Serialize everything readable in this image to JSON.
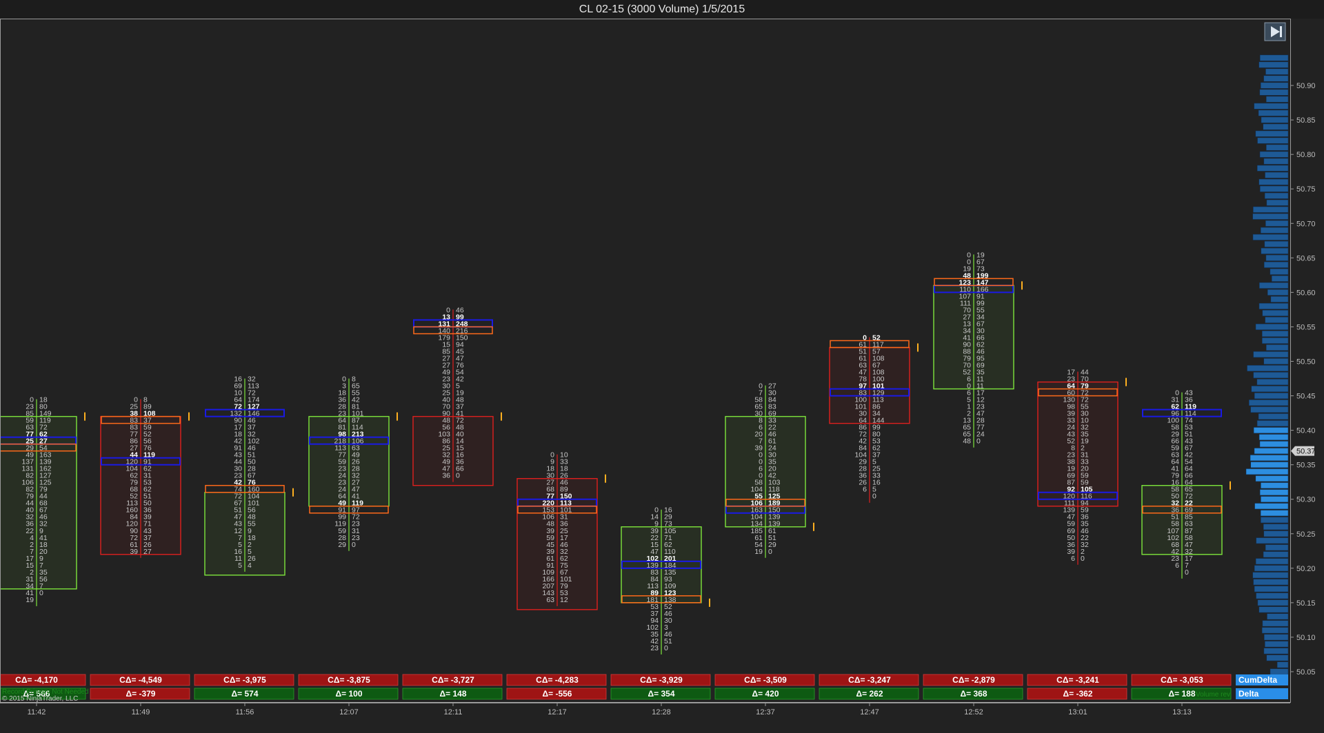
{
  "title": "CL 02-15 (3000 Volume)  1/5/2015",
  "buttons": {
    "go_to_end_icon": "skip-to-end-icon"
  },
  "footer": {
    "status_text": "Record Primary Not Needed",
    "copyright": "© 2015 NinjaTrader, LLC",
    "volume_label": "Volume rev"
  },
  "labels": {
    "cum_delta": "CumDelta",
    "delta": "Delta"
  },
  "colors": {
    "background": "#222222",
    "bull": "#7ee63c",
    "bear": "#e0201e",
    "poc": "#1a1ae6",
    "va_edge": "#ff6a1a",
    "profile_bar": "#1e5a96",
    "profile_hi": "#2d8ee0",
    "cum_cell": "#9e1414",
    "pos_delta": "#0e5a12",
    "neg_delta": "#9e1414",
    "label_bg": "#2a8ee8"
  },
  "chart_data": {
    "type": "footprint",
    "yaxis": {
      "ticks": [
        "50.90",
        "50.85",
        "50.80",
        "50.75",
        "50.70",
        "50.65",
        "50.60",
        "50.55",
        "50.50",
        "50.45",
        "50.40",
        "50.35",
        "50.30",
        "50.25",
        "50.20",
        "50.15",
        "50.10",
        "50.05"
      ],
      "min": 50.03,
      "max": 50.95,
      "last_price": "50.37"
    },
    "bars": [
      {
        "time": "11:42",
        "top": 50.44,
        "dir": "bull",
        "open": 50.42,
        "close": 50.17,
        "pocRow": 6,
        "vaRow": 7,
        "cum": "CΔ= -4,170",
        "delta": "Δ= 566",
        "deltaSign": "pos",
        "bid": [
          "0",
          "23",
          "85",
          "59",
          "63",
          "77",
          "25",
          "29",
          "49",
          "137",
          "131",
          "82",
          "106",
          "82",
          "79",
          "44",
          "40",
          "32",
          "36",
          "22",
          "4",
          "2",
          "7",
          "17",
          "15",
          "2",
          "31",
          "34",
          "41",
          "19"
        ],
        "ask": [
          "18",
          "80",
          "149",
          "119",
          "72",
          "62",
          "27",
          "54",
          "163",
          "139",
          "162",
          "127",
          "125",
          "79",
          "44",
          "68",
          "67",
          "46",
          "32",
          "9",
          "41",
          "18",
          "20",
          "9",
          "7",
          "35",
          "56",
          "7",
          "0",
          ""
        ]
      },
      {
        "time": "11:49",
        "top": 50.44,
        "dir": "bear",
        "open": 50.42,
        "close": 50.22,
        "pocRow": 9,
        "vaRow": 3,
        "cum": "CΔ= -4,549",
        "delta": "Δ= -379",
        "deltaSign": "neg",
        "bid": [
          "0",
          "25",
          "38",
          "83",
          "83",
          "77",
          "86",
          "27",
          "44",
          "120",
          "104",
          "62",
          "79",
          "68",
          "52",
          "113",
          "160",
          "84",
          "120",
          "90",
          "72",
          "61",
          "39"
        ],
        "ask": [
          "8",
          "89",
          "108",
          "37",
          "59",
          "52",
          "56",
          "76",
          "119",
          "91",
          "62",
          "31",
          "53",
          "62",
          "51",
          "50",
          "36",
          "39",
          "71",
          "43",
          "37",
          "26",
          "27"
        ]
      },
      {
        "time": "11:56",
        "top": 50.47,
        "dir": "bull",
        "open": 50.31,
        "close": 50.19,
        "pocRow": 5,
        "vaRow": 16,
        "cum": "CΔ= -3,975",
        "delta": "Δ= 574",
        "deltaSign": "pos",
        "bid": [
          "16",
          "69",
          "10",
          "64",
          "72",
          "132",
          "90",
          "17",
          "18",
          "42",
          "91",
          "43",
          "44",
          "30",
          "23",
          "42",
          "74",
          "72",
          "67",
          "51",
          "47",
          "43",
          "12",
          "7",
          "5",
          "16",
          "11",
          "5"
        ],
        "ask": [
          "32",
          "113",
          "72",
          "174",
          "127",
          "146",
          "46",
          "37",
          "32",
          "102",
          "46",
          "51",
          "50",
          "28",
          "67",
          "76",
          "160",
          "104",
          "101",
          "56",
          "48",
          "55",
          "9",
          "18",
          "2",
          "5",
          "26",
          "4"
        ]
      },
      {
        "time": "12:07",
        "top": 50.47,
        "dir": "bull",
        "open": 50.42,
        "close": 50.29,
        "pocRow": 9,
        "vaRow": 19,
        "cum": "CΔ= -3,875",
        "delta": "Δ= 100",
        "deltaSign": "pos",
        "bid": [
          "0",
          "3",
          "18",
          "36",
          "28",
          "23",
          "64",
          "81",
          "98",
          "218",
          "113",
          "77",
          "59",
          "23",
          "24",
          "23",
          "24",
          "64",
          "49",
          "91",
          "99",
          "119",
          "59",
          "28",
          "29"
        ],
        "ask": [
          "8",
          "65",
          "55",
          "42",
          "81",
          "101",
          "87",
          "114",
          "213",
          "106",
          "63",
          "49",
          "26",
          "28",
          "32",
          "27",
          "47",
          "41",
          "119",
          "97",
          "72",
          "23",
          "31",
          "23",
          "0"
        ]
      },
      {
        "time": "12:11",
        "top": 50.57,
        "dir": "bear",
        "open": 50.42,
        "close": 50.32,
        "pocRow": 2,
        "vaRow": 3,
        "cum": "CΔ= -3,727",
        "delta": "Δ= 148",
        "deltaSign": "pos",
        "bid": [
          "0",
          "13",
          "131",
          "140",
          "179",
          "15",
          "85",
          "27",
          "27",
          "49",
          "23",
          "30",
          "25",
          "40",
          "70",
          "90",
          "48",
          "56",
          "103",
          "86",
          "25",
          "32",
          "49",
          "47",
          "36"
        ],
        "ask": [
          "46",
          "99",
          "248",
          "216",
          "150",
          "94",
          "45",
          "47",
          "76",
          "54",
          "42",
          "5",
          "19",
          "48",
          "37",
          "41",
          "72",
          "48",
          "40",
          "14",
          "15",
          "16",
          "36",
          "66",
          "0"
        ]
      },
      {
        "time": "12:17",
        "top": 50.36,
        "dir": "bear",
        "open": 50.33,
        "close": 50.14,
        "pocRow": 7,
        "vaRow": 8,
        "cum": "CΔ= -4,283",
        "delta": "Δ= -556",
        "deltaSign": "neg",
        "bid": [
          "0",
          "9",
          "18",
          "30",
          "27",
          "68",
          "77",
          "220",
          "153",
          "106",
          "48",
          "39",
          "59",
          "45",
          "39",
          "61",
          "91",
          "109",
          "166",
          "207",
          "143",
          "63"
        ],
        "ask": [
          "10",
          "33",
          "18",
          "26",
          "46",
          "89",
          "150",
          "113",
          "101",
          "31",
          "36",
          "25",
          "17",
          "46",
          "32",
          "62",
          "75",
          "67",
          "101",
          "79",
          "53",
          "12"
        ]
      },
      {
        "time": "12:28",
        "top": 50.28,
        "dir": "bull",
        "open": 50.15,
        "close": 50.26,
        "pocRow": 8,
        "vaRow": 13,
        "cum": "CΔ= -3,929",
        "delta": "Δ= 354",
        "deltaSign": "pos",
        "bid": [
          "0",
          "14",
          "9",
          "39",
          "22",
          "15",
          "47",
          "102",
          "139",
          "83",
          "84",
          "113",
          "89",
          "181",
          "53",
          "37",
          "94",
          "102",
          "35",
          "42",
          "23"
        ],
        "ask": [
          "16",
          "29",
          "73",
          "105",
          "71",
          "62",
          "110",
          "201",
          "184",
          "135",
          "93",
          "109",
          "123",
          "138",
          "52",
          "46",
          "30",
          "3",
          "46",
          "51",
          "0"
        ]
      },
      {
        "time": "12:37",
        "top": 50.46,
        "dir": "bull",
        "open": 50.26,
        "close": 50.42,
        "pocRow": 18,
        "vaRow": 17,
        "cum": "CΔ= -3,509",
        "delta": "Δ= 420",
        "deltaSign": "pos",
        "bid": [
          "0",
          "7",
          "58",
          "65",
          "30",
          "8",
          "6",
          "20",
          "7",
          "39",
          "0",
          "0",
          "6",
          "0",
          "58",
          "104",
          "55",
          "106",
          "163",
          "104",
          "134",
          "185",
          "61",
          "54",
          "19"
        ],
        "ask": [
          "27",
          "30",
          "84",
          "83",
          "69",
          "33",
          "22",
          "46",
          "61",
          "24",
          "30",
          "35",
          "20",
          "42",
          "103",
          "118",
          "125",
          "189",
          "150",
          "139",
          "139",
          "61",
          "51",
          "29",
          "0"
        ]
      },
      {
        "time": "12:47",
        "top": 50.53,
        "dir": "bear",
        "open": 50.52,
        "close": 50.41,
        "pocRow": 8,
        "vaRow": 1,
        "cum": "CΔ= -3,247",
        "delta": "Δ= 262",
        "deltaSign": "pos",
        "bid": [
          "0",
          "61",
          "51",
          "61",
          "63",
          "47",
          "78",
          "97",
          "83",
          "100",
          "101",
          "30",
          "64",
          "86",
          "72",
          "42",
          "84",
          "104",
          "29",
          "28",
          "36",
          "26",
          "6"
        ],
        "ask": [
          "52",
          "117",
          "57",
          "108",
          "67",
          "108",
          "100",
          "101",
          "129",
          "113",
          "86",
          "34",
          "144",
          "99",
          "80",
          "53",
          "62",
          "37",
          "5",
          "25",
          "33",
          "16",
          "5",
          "0"
        ]
      },
      {
        "time": "12:52",
        "top": 50.65,
        "dir": "bull",
        "open": 50.61,
        "close": 50.46,
        "pocRow": 5,
        "vaRow": 4,
        "cum": "CΔ= -2,879",
        "delta": "Δ= 368",
        "deltaSign": "pos",
        "bid": [
          "0",
          "0",
          "19",
          "48",
          "123",
          "110",
          "107",
          "111",
          "70",
          "27",
          "13",
          "34",
          "41",
          "90",
          "88",
          "79",
          "70",
          "52",
          "6",
          "0",
          "6",
          "5",
          "1",
          "2",
          "13",
          "65",
          "65",
          "48"
        ],
        "ask": [
          "19",
          "67",
          "73",
          "199",
          "147",
          "166",
          "91",
          "99",
          "55",
          "34",
          "67",
          "30",
          "66",
          "62",
          "46",
          "95",
          "69",
          "35",
          "11",
          "11",
          "17",
          "12",
          "23",
          "47",
          "28",
          "77",
          "24",
          "0"
        ]
      },
      {
        "time": "13:01",
        "top": 50.48,
        "dir": "bear",
        "open": 50.47,
        "close": 50.29,
        "pocRow": 18,
        "vaRow": 3,
        "cum": "CΔ= -3,241",
        "delta": "Δ= -362",
        "deltaSign": "neg",
        "bid": [
          "17",
          "23",
          "64",
          "60",
          "130",
          "98",
          "39",
          "33",
          "24",
          "43",
          "52",
          "8",
          "23",
          "38",
          "19",
          "69",
          "87",
          "92",
          "120",
          "111",
          "139",
          "47",
          "59",
          "69",
          "50",
          "36",
          "39",
          "6"
        ],
        "ask": [
          "44",
          "70",
          "79",
          "72",
          "72",
          "55",
          "30",
          "10",
          "32",
          "35",
          "19",
          "2",
          "31",
          "33",
          "20",
          "59",
          "59",
          "105",
          "116",
          "94",
          "59",
          "36",
          "35",
          "46",
          "22",
          "32",
          "2",
          "0"
        ]
      },
      {
        "time": "13:13",
        "top": 50.45,
        "dir": "bull",
        "open": 50.32,
        "close": 50.22,
        "pocRow": 3,
        "vaRow": 17,
        "cum": "CΔ= -3,053",
        "delta": "Δ= 188",
        "deltaSign": "pos",
        "bid": [
          "0",
          "31",
          "62",
          "96",
          "100",
          "58",
          "29",
          "66",
          "59",
          "63",
          "64",
          "41",
          "79",
          "16",
          "58",
          "50",
          "32",
          "36",
          "51",
          "58",
          "107",
          "102",
          "68",
          "42",
          "23",
          "6"
        ],
        "ask": [
          "43",
          "36",
          "119",
          "114",
          "74",
          "53",
          "51",
          "43",
          "67",
          "42",
          "54",
          "64",
          "66",
          "64",
          "65",
          "72",
          "22",
          "69",
          "85",
          "63",
          "87",
          "58",
          "47",
          "32",
          "17",
          "7",
          "0"
        ]
      }
    ]
  }
}
